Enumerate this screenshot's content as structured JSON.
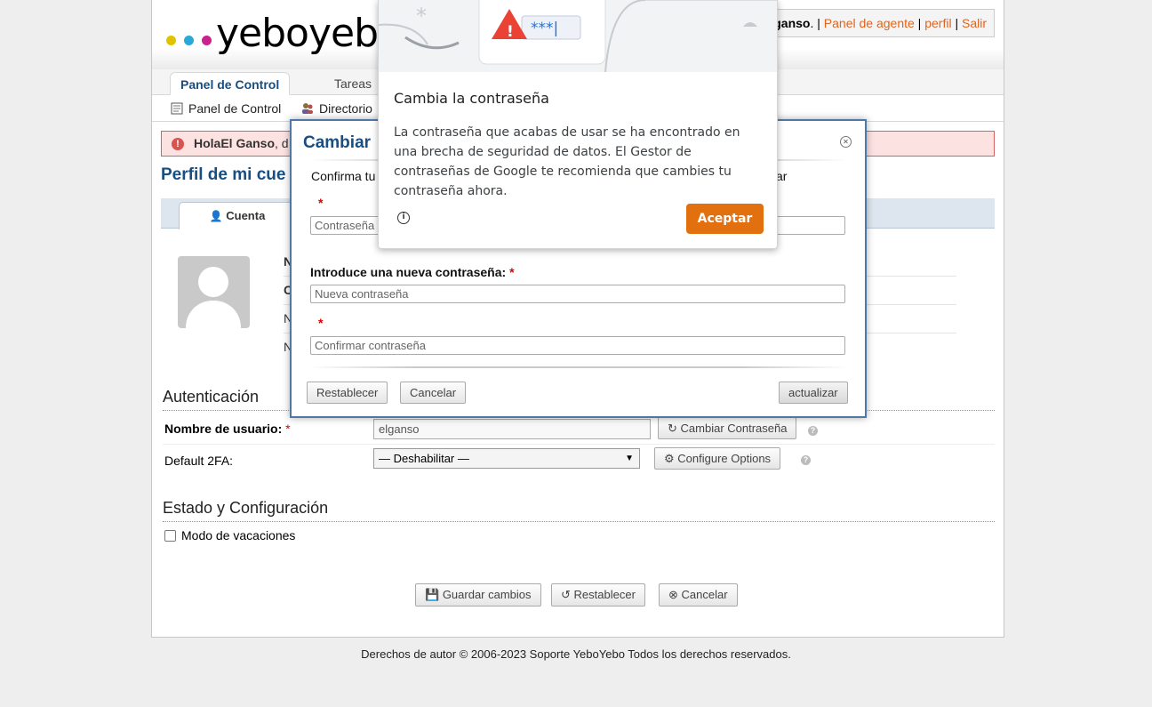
{
  "header": {
    "logo_text": "yeboyebo",
    "user_name": "ganso",
    "user_suffix": ". | ",
    "links": {
      "agent_panel": "Panel de agente",
      "sep1": " | ",
      "profile": "perfil",
      "sep2": " | ",
      "logout": "Salir"
    }
  },
  "nav": {
    "tabs": [
      {
        "label": "Panel de Control"
      },
      {
        "label": "Tareas"
      }
    ],
    "sub_items": [
      {
        "label": "Panel de Control"
      },
      {
        "label": "Directorio"
      }
    ]
  },
  "alert": {
    "greeting": "HolaEl Ganso",
    "tail": ", d"
  },
  "page": {
    "title": "Perfil de mi cue",
    "tab_label": "Cuenta",
    "info_initials": [
      "N",
      "C",
      "N",
      "N"
    ]
  },
  "auth": {
    "heading": "Autenticación",
    "username_label": "Nombre de usuario:",
    "username_value": "elganso",
    "change_password_button": "Cambiar Contraseña",
    "twofa_label": "Default 2FA:",
    "twofa_value": "— Deshabilitar —",
    "configure_button": "Configure Options"
  },
  "status": {
    "heading": "Estado y Configuración",
    "vacation_label": "Modo de vacaciones"
  },
  "actions": {
    "save": "Guardar cambios",
    "reset": "Restablecer",
    "cancel": "Cancelar"
  },
  "footer": {
    "text": "Derechos de autor © 2006-2023 Soporte YeboYebo Todos los derechos reservados."
  },
  "modal": {
    "title": "Cambiar",
    "intro_left": "Confirma tu",
    "intro_right": "ar",
    "current_password_placeholder": "Contraseña",
    "new_password_label": "Introduce una nueva contraseña:",
    "new_password_placeholder": "Nueva contraseña",
    "confirm_password_placeholder": "Confirmar contraseña",
    "reset_button": "Restablecer",
    "cancel_button": "Cancelar",
    "update_button": "actualizar"
  },
  "google_popup": {
    "password_mask": "***|",
    "title": "Cambia la contraseña",
    "body": "La contraseña que acabas de usar se ha encontrado en una brecha de seguridad de datos. El Gestor de contraseñas de Google te recomienda que cambies tu contraseña ahora.",
    "accept_button": "Aceptar"
  },
  "colors": {
    "brand_blue": "#184e81",
    "link_orange": "#e2631c",
    "alert_red": "#d46464",
    "google_orange": "#e2700f"
  }
}
